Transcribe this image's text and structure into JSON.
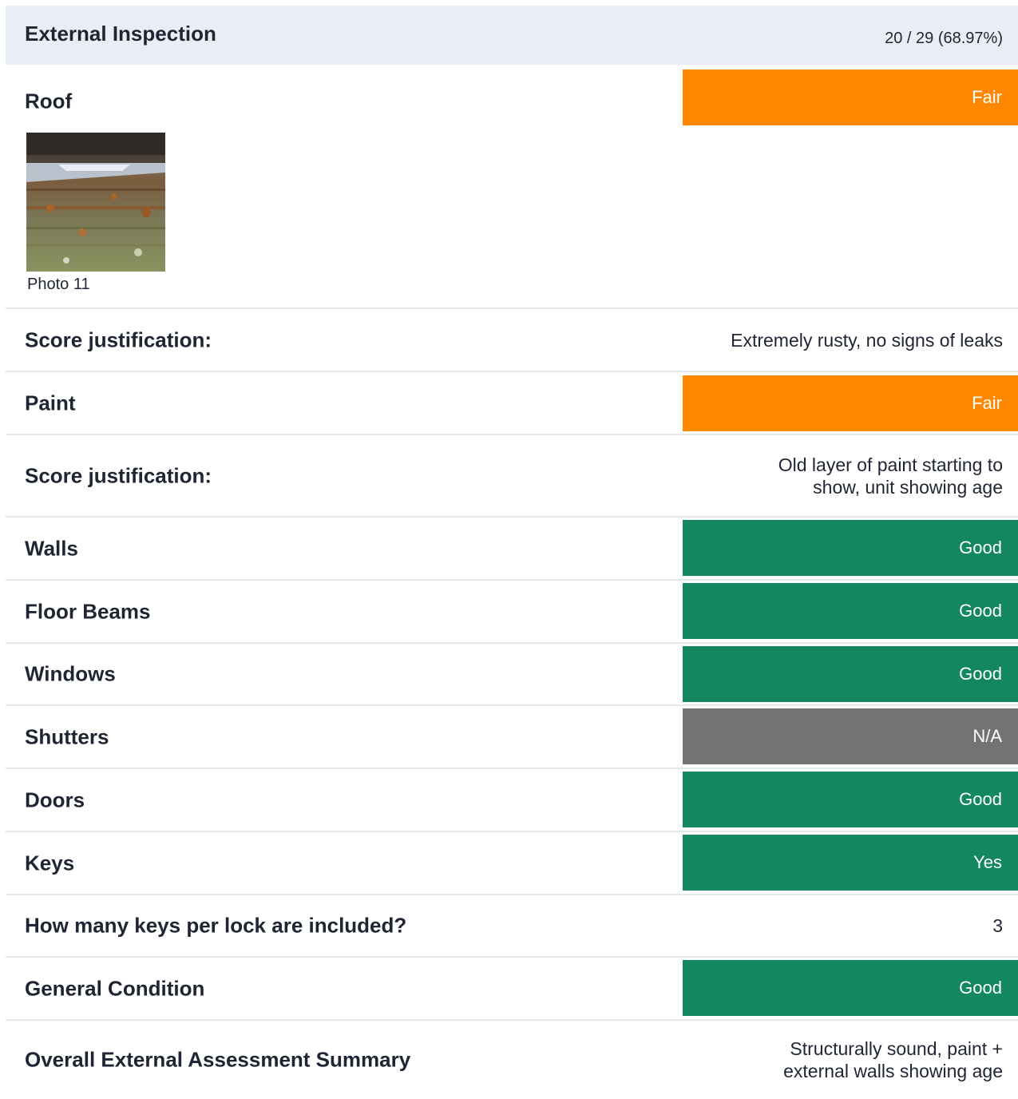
{
  "section": {
    "title": "External Inspection",
    "score": "20 / 29 (68.97%)"
  },
  "rating_colors": {
    "Fair": "#ff8800",
    "Good": "#13875f",
    "Yes": "#13875f",
    "N/A": "#737373"
  },
  "roof": {
    "label": "Roof",
    "rating": "Fair",
    "photo_caption": "Photo 11",
    "justification_label": "Score justification:",
    "justification": "Extremely rusty, no signs of leaks"
  },
  "paint": {
    "label": "Paint",
    "rating": "Fair",
    "justification_label": "Score justification:",
    "justification_line1": "Old layer of paint starting to",
    "justification_line2": "show, unit showing age"
  },
  "walls": {
    "label": "Walls",
    "rating": "Good"
  },
  "floor_beams": {
    "label": "Floor Beams",
    "rating": "Good"
  },
  "windows": {
    "label": "Windows",
    "rating": "Good"
  },
  "shutters": {
    "label": "Shutters",
    "rating": "N/A"
  },
  "doors": {
    "label": "Doors",
    "rating": "Good"
  },
  "keys": {
    "label": "Keys",
    "rating": "Yes"
  },
  "keys_per_lock": {
    "label": "How many keys per lock are included?",
    "value": "3"
  },
  "general_condition": {
    "label": "General Condition",
    "rating": "Good"
  },
  "summary": {
    "label": "Overall External Assessment Summary",
    "line1": "Structurally sound, paint +",
    "line2": "external walls showing age"
  }
}
